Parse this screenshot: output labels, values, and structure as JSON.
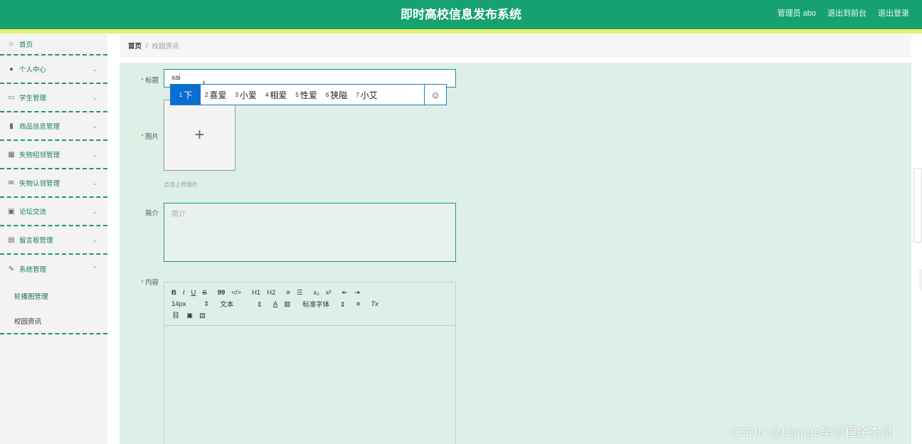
{
  "header": {
    "title": "即时高校信息发布系统",
    "links": [
      "管理员 abo",
      "退出到前台",
      "退出登录"
    ]
  },
  "sidebar": {
    "items": [
      {
        "label": "首页",
        "icon": "home-icon"
      },
      {
        "label": "个人中心",
        "icon": "user-icon"
      },
      {
        "label": "学生管理",
        "icon": "photo-icon"
      },
      {
        "label": "商品信息管理",
        "icon": "bar-chart-icon"
      },
      {
        "label": "失物招领管理",
        "icon": "grid-icon"
      },
      {
        "label": "失物认领管理",
        "icon": "mail-icon"
      },
      {
        "label": "论坛交流",
        "icon": "clipboard-icon"
      },
      {
        "label": "留言板管理",
        "icon": "table-icon"
      },
      {
        "label": "系统管理",
        "icon": "edit-icon"
      }
    ],
    "sub_items": [
      "轮播图管理",
      "校园资讯"
    ]
  },
  "breadcrumb": {
    "home": "首页",
    "separator": "/",
    "current": "校园资讯"
  },
  "form": {
    "title_label": "标题",
    "title_value": "xai",
    "image_label": "图片",
    "image_tip": "点击上传图片",
    "intro_label": "简介",
    "intro_placeholder": "简介",
    "content_label": "内容"
  },
  "ime": {
    "candidates": [
      {
        "n": "1",
        "text": "下"
      },
      {
        "n": "2",
        "text": "喜爱"
      },
      {
        "n": "3",
        "text": "小爱"
      },
      {
        "n": "4",
        "text": "相爱"
      },
      {
        "n": "5",
        "text": "性爱"
      },
      {
        "n": "6",
        "text": "狭隘"
      },
      {
        "n": "7",
        "text": "小艾"
      }
    ],
    "emoji": "☺"
  },
  "editor": {
    "row1": [
      "B",
      "I",
      "U",
      "S",
      "99",
      "</>",
      "H1",
      "H2",
      "≡",
      "☰",
      "x₂",
      "x²",
      "⇤",
      "⇥"
    ],
    "font_size": "14px",
    "block_type": "文本",
    "font_family": "标准字体",
    "row3": [
      "🔗",
      "🖼",
      "🎞"
    ]
  },
  "watermark": "CSDN @Django毕设程序杰哥",
  "colors": {
    "primary": "#16a270",
    "accent_bar": "#e8f06a",
    "content_bg": "#deefe8",
    "ime_selected": "#0a6ed1"
  }
}
